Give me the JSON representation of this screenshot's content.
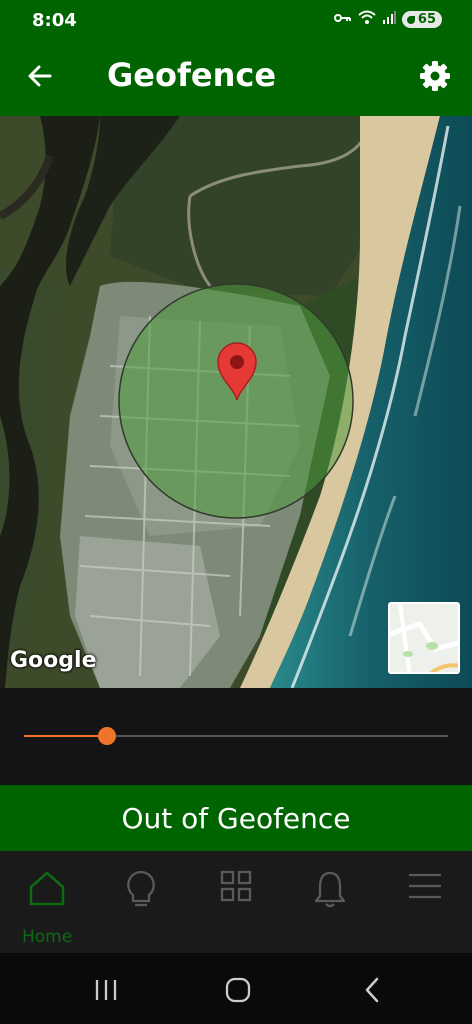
{
  "status_bar": {
    "time": "8:04",
    "battery": "65",
    "icons": [
      "key-icon",
      "wifi-icon",
      "signal-icon",
      "battery-icon"
    ]
  },
  "app_bar": {
    "title": "Geofence",
    "back_icon": "arrow-left-icon",
    "settings_icon": "gear-icon"
  },
  "map": {
    "attribution": "Google",
    "geofence_color": "#4f9a3c",
    "pin_color": "#e53935"
  },
  "slider": {
    "value": 0.195,
    "accent": "#f07428"
  },
  "geofence_status": "Out of Geofence",
  "bottom_nav": {
    "items": [
      {
        "icon": "home-icon",
        "label": "Home",
        "active": true
      },
      {
        "icon": "lightbulb-icon",
        "label": "",
        "active": false
      },
      {
        "icon": "grid-icon",
        "label": "",
        "active": false
      },
      {
        "icon": "bell-icon",
        "label": "",
        "active": false
      },
      {
        "icon": "menu-icon",
        "label": "",
        "active": false
      }
    ],
    "active_color": "#0d6b12"
  },
  "system_nav": [
    "recents-icon",
    "home-circle-icon",
    "back-chevron-icon"
  ]
}
